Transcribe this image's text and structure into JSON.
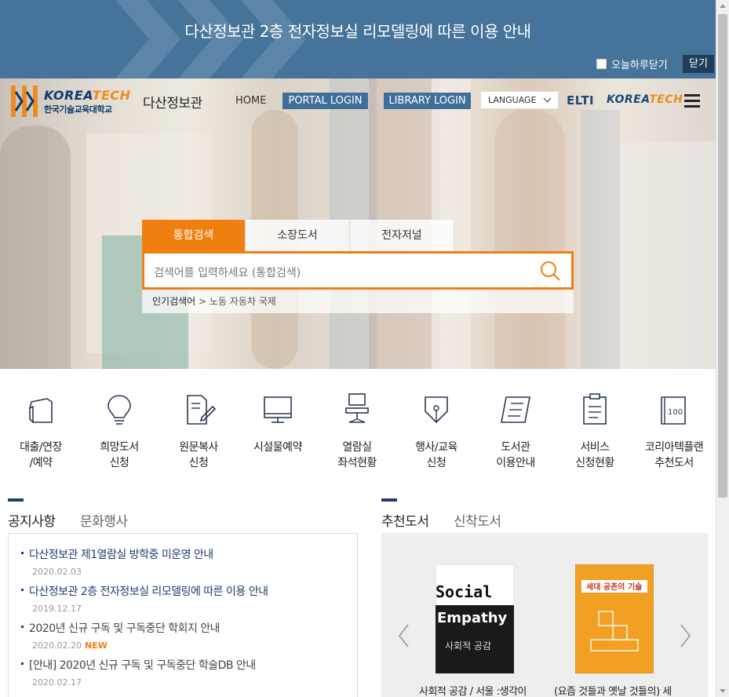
{
  "banner": {
    "notice": "다산정보관 2층 전자정보실 리모델링에 따른 이용 안내",
    "today_close": "오늘하루닫기",
    "close": "닫기"
  },
  "header": {
    "logo_en_a": "KOREA",
    "logo_en_b": "TECH",
    "logo_kr": "한국기술교육대학교",
    "site_name": "다산정보관",
    "home": "HOME",
    "portal_login": "PORTAL LOGIN",
    "library_login": "LIBRARY LOGIN",
    "language": "LANGUAGE",
    "elti": "ELTI",
    "kt_a": "KOREA",
    "kt_b": "TECH"
  },
  "search": {
    "tabs": [
      "통합검색",
      "소장도서",
      "전자저널"
    ],
    "placeholder": "검색어를 입력하세요 (통합검색)",
    "popular_label": "인기검색어",
    "popular_terms": "노동 자동차 국제"
  },
  "quick_menu": [
    {
      "icon": "book-loan-icon",
      "label": "대출/연장\n/예약"
    },
    {
      "icon": "lightbulb-icon",
      "label": "희망도서\n신청"
    },
    {
      "icon": "document-pen-icon",
      "label": "원문복사\n신청"
    },
    {
      "icon": "monitor-icon",
      "label": "시설물예약"
    },
    {
      "icon": "chair-icon",
      "label": "열람실\n좌석현황"
    },
    {
      "icon": "pen-nib-icon",
      "label": "행사/교육\n신청"
    },
    {
      "icon": "info-board-icon",
      "label": "도서관\n이용안내"
    },
    {
      "icon": "clipboard-icon",
      "label": "서비스\n신청현황"
    },
    {
      "icon": "book-100-icon",
      "label": "코리아텍플랜\n추천도서"
    }
  ],
  "notices": {
    "tabs": [
      "공지사항",
      "문화행사"
    ],
    "items": [
      {
        "title": "다산정보관 제1열람실 방학중 미운영 안내",
        "date": "2020.02.03",
        "new": "",
        "color": "#1f3d72"
      },
      {
        "title": "다산정보관 2층 전자정보실 리모델링에 따른 이용 안내",
        "date": "2019.12.17",
        "new": "",
        "color": "#1f3d72"
      },
      {
        "title": "2020년 신규 구독 및 구독중단 학회지 안내",
        "date": "2020.02.20",
        "new": "NEW",
        "color": "#444444"
      },
      {
        "title": "[안내] 2020년 신규 구독 및 구독중단 학술DB 안내",
        "date": "2020.02.17",
        "new": "",
        "color": "#444444"
      }
    ]
  },
  "books": {
    "tabs": [
      "추천도서",
      "신착도서"
    ],
    "items": [
      {
        "title": "사회적 공감 / 서울 :생각이",
        "cover_en_a": "Social",
        "cover_en_b": "Empathy",
        "cover_kr": "사회적 공감"
      },
      {
        "title": "(요즘 것들과 옛날 것들의) 세",
        "cover_kr": "세대 공존의 기술"
      }
    ]
  },
  "colors": {
    "banner": "#45739a",
    "accent_orange": "#f07f12",
    "nav_button": "#3f6f99",
    "navy": "#1f3d72"
  }
}
